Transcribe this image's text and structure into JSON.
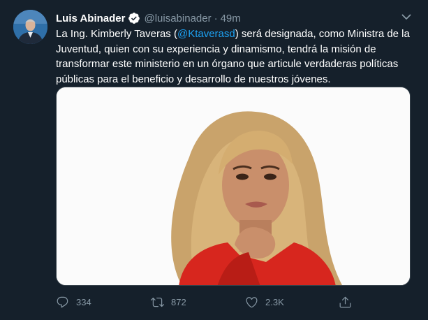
{
  "tweet": {
    "author_name": "Luis Abinader",
    "handle": "@luisabinader",
    "separator": "·",
    "time": "49m",
    "text_before": "La Ing. Kimberly Taveras (",
    "mention": "@Ktaverasd",
    "text_after": ") será designada, como Ministra de la Juventud, quien con su experiencia y dinamismo, tendrá la misión de transformar este ministerio en un órgano que articule verdaderas políticas públicas para el beneficio y desarrollo de nuestros jóvenes.",
    "actions": {
      "reply_count": "334",
      "retweet_count": "872",
      "like_count": "2.3K"
    }
  },
  "colors": {
    "background": "#15202b",
    "text": "#ffffff",
    "secondary": "#8899a6",
    "link": "#1da1f2"
  },
  "icons": [
    "verified-badge-icon",
    "chevron-down-icon",
    "reply-icon",
    "retweet-icon",
    "like-icon",
    "share-icon"
  ]
}
